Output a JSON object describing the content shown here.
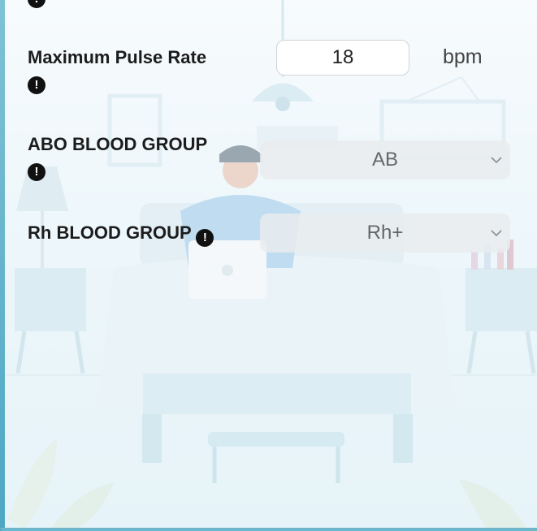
{
  "form": {
    "pulse": {
      "label": "Maximum Pulse Rate",
      "value": "18",
      "unit": "bpm"
    },
    "abo": {
      "label": "ABO BLOOD GROUP",
      "selected": "AB"
    },
    "rh": {
      "label": "Rh BLOOD GROUP",
      "selected": "Rh+"
    }
  },
  "icons": {
    "info": "exclamation-circle-icon",
    "dropdown": "chevron-down-icon"
  },
  "colors": {
    "label_text": "#1c1c1c",
    "select_bg": "#e9ecee",
    "frame_accent": "#4ea7c3"
  }
}
